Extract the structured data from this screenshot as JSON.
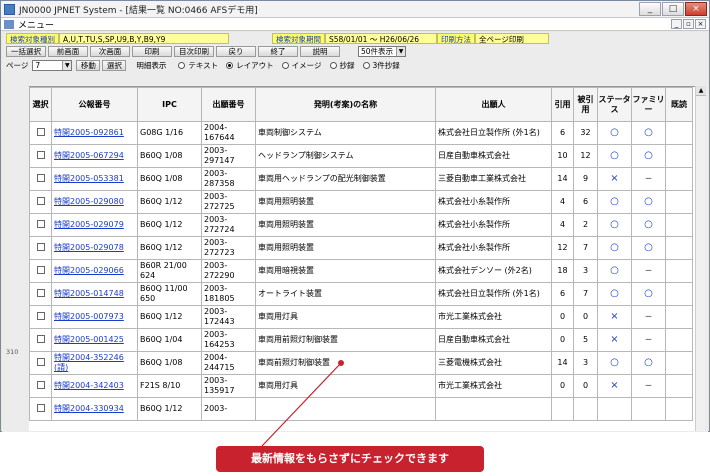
{
  "window": {
    "title": "JN0000 JPNET System - [結果一覧 NO:0466 AFSデモ用]",
    "controls": [
      "_",
      "□",
      "×"
    ]
  },
  "menubar": {
    "label": "メニュー",
    "mdi_controls": [
      "_",
      "▫",
      "×"
    ]
  },
  "criteria": {
    "target_class_label": "検索対象種別",
    "target_class_value": "A,U,T,TU,S,SP,U9,B,Y,B9,Y9",
    "target_period_label": "検索対象期間",
    "target_period_value": "S58/01/01 〜 H26/06/26",
    "print_method_label": "印刷方法",
    "print_method_value": "全ページ印刷"
  },
  "toolbar": {
    "buttons": [
      "一括選択",
      "前画面",
      "次画面",
      "印刷",
      "目次印刷",
      "戻り",
      "終了",
      "説明"
    ],
    "display_count": "50件表示"
  },
  "row3": {
    "page_label": "ページ",
    "page_value": "7",
    "move_button": "移動",
    "select_button": "選択",
    "detail_label": "明細表示",
    "options": [
      {
        "label": "テキスト",
        "selected": false
      },
      {
        "label": "レイアウト",
        "selected": true
      },
      {
        "label": "イメージ",
        "selected": false
      },
      {
        "label": "抄録",
        "selected": false
      },
      {
        "label": "3件抄録",
        "selected": false
      }
    ]
  },
  "table": {
    "headers": [
      "選択",
      "公報番号",
      "IPC",
      "出願番号",
      "発明(考案)の名称",
      "出願人",
      "引用",
      "被引用",
      "ステータス",
      "ファミリー",
      "既読"
    ],
    "rows": [
      {
        "pub": "特開2005-092861",
        "ipc": "G08G 1/16",
        "app": "2004-167644",
        "title": "車両制御システム",
        "applicant": "株式会社日立製作所 (外1名)",
        "cite": "6",
        "cited": "32",
        "status": "○",
        "family": "○",
        "read": ""
      },
      {
        "pub": "特開2005-067294",
        "ipc": "B60Q 1/08",
        "app": "2003-297147",
        "title": "ヘッドランプ制御システム",
        "applicant": "日産自動車株式会社",
        "cite": "10",
        "cited": "12",
        "status": "○",
        "family": "○",
        "read": ""
      },
      {
        "pub": "特開2005-053381",
        "ipc": "B60Q 1/08",
        "app": "2003-287358",
        "title": "車両用ヘッドランプの配光制御装置",
        "applicant": "三菱自動車工業株式会社",
        "cite": "14",
        "cited": "9",
        "status": "×",
        "family": "－",
        "read": ""
      },
      {
        "pub": "特開2005-029080",
        "ipc": "B60Q 1/12",
        "app": "2003-272725",
        "title": "車両用照明装置",
        "applicant": "株式会社小糸製作所",
        "cite": "4",
        "cited": "6",
        "status": "○",
        "family": "○",
        "read": ""
      },
      {
        "pub": "特開2005-029079",
        "ipc": "B60Q 1/12",
        "app": "2003-272724",
        "title": "車両用照明装置",
        "applicant": "株式会社小糸製作所",
        "cite": "4",
        "cited": "2",
        "status": "○",
        "family": "○",
        "read": ""
      },
      {
        "pub": "特開2005-029078",
        "ipc": "B60Q 1/12",
        "app": "2003-272723",
        "title": "車両用照明装置",
        "applicant": "株式会社小糸製作所",
        "cite": "12",
        "cited": "7",
        "status": "○",
        "family": "○",
        "read": ""
      },
      {
        "pub": "特開2005-029066",
        "ipc": "B60R 21/00 624",
        "app": "2003-272290",
        "title": "車両用暗視装置",
        "applicant": "株式会社デンソー (外2名)",
        "cite": "18",
        "cited": "3",
        "status": "○",
        "family": "－",
        "read": ""
      },
      {
        "pub": "特開2005-014748",
        "ipc": "B60Q 11/00 650",
        "app": "2003-181805",
        "title": "オートライト装置",
        "applicant": "株式会社日立製作所 (外1名)",
        "cite": "6",
        "cited": "7",
        "status": "○",
        "family": "○",
        "read": ""
      },
      {
        "pub": "特開2005-007973",
        "ipc": "B60Q 1/12",
        "app": "2003-172443",
        "title": "車両用灯具",
        "applicant": "市光工業株式会社",
        "cite": "0",
        "cited": "0",
        "status": "×",
        "family": "－",
        "read": ""
      },
      {
        "pub": "特開2005-001425",
        "ipc": "B60Q 1/04",
        "app": "2003-164253",
        "title": "車両用前照灯制御装置",
        "applicant": "日産自動車株式会社",
        "cite": "0",
        "cited": "5",
        "status": "×",
        "family": "－",
        "read": ""
      },
      {
        "pub": "特開2004-352246 (請)",
        "ipc": "B60Q 1/08",
        "app": "2004-244715",
        "title": "車両前照灯制御装置",
        "applicant": "三菱電機株式会社",
        "cite": "14",
        "cited": "3",
        "status": "○",
        "family": "○",
        "read": ""
      },
      {
        "pub": "特開2004-342403",
        "ipc": "F21S 8/10",
        "app": "2003-135917",
        "title": "車両用灯具",
        "applicant": "市光工業株式会社",
        "cite": "0",
        "cited": "0",
        "status": "×",
        "family": "－",
        "read": ""
      },
      {
        "pub": "特開2004-330934",
        "ipc": "B60Q 1/12",
        "app": "2003-",
        "title": "",
        "applicant": "",
        "cite": "",
        "cited": "",
        "status": "",
        "family": "",
        "read": ""
      }
    ]
  },
  "side_number": "310",
  "callout": {
    "text": "最新情報をもらさずにチェックできます",
    "color": "#c8222f"
  }
}
